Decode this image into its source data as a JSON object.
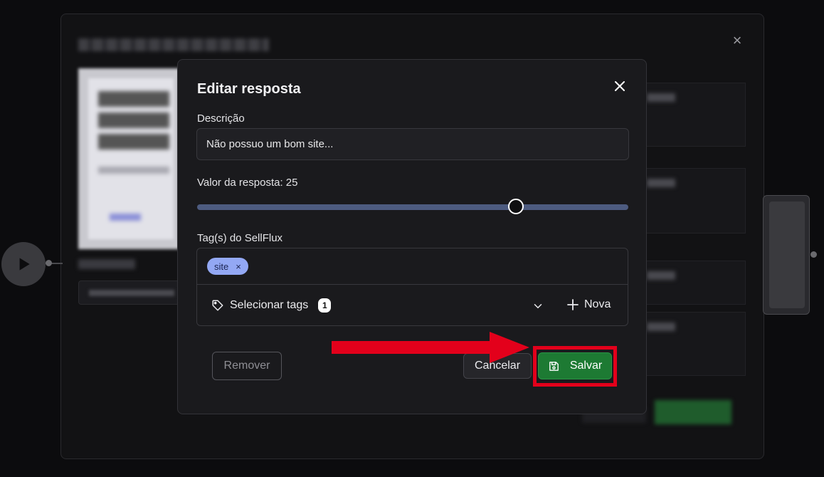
{
  "modal": {
    "title": "Editar resposta",
    "description_label": "Descrição",
    "description_value": "Não possuo um bom site...",
    "slider_label": "Valor da resposta: 25",
    "slider_fraction": 0.74,
    "tags_label": "Tag(s) do SellFlux",
    "selected_tags": [
      {
        "label": "site"
      }
    ],
    "chip_remove_glyph": "×",
    "select_tags_label": "Selecionar tags",
    "selected_count": "1",
    "new_tag_label": "Nova",
    "remove_label": "Remover",
    "cancel_label": "Cancelar",
    "save_label": "Salvar"
  },
  "background": {
    "close_glyph": "×"
  },
  "colors": {
    "save_green": "#1d7a33",
    "tag_chip": "#93a8f4",
    "annotation_red": "#e3001b",
    "slider_track": "#4d5b80"
  },
  "icons": {
    "modal_close": "close-icon",
    "select_tags": "tag-icon",
    "dropdown": "chevron-down-icon",
    "new_tag": "plus-icon",
    "save": "save-icon",
    "play": "play-icon"
  }
}
